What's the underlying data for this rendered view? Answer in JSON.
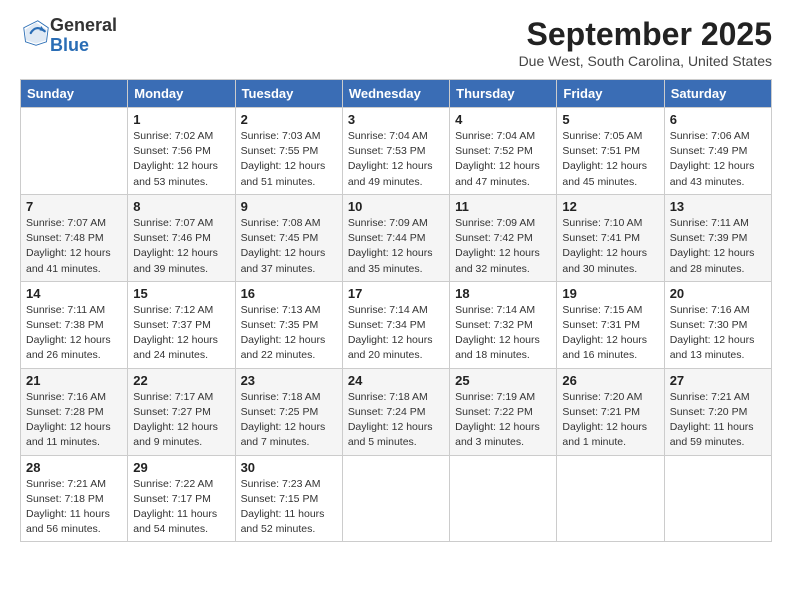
{
  "header": {
    "logo_general": "General",
    "logo_blue": "Blue",
    "month_title": "September 2025",
    "location": "Due West, South Carolina, United States"
  },
  "columns": [
    "Sunday",
    "Monday",
    "Tuesday",
    "Wednesday",
    "Thursday",
    "Friday",
    "Saturday"
  ],
  "weeks": [
    [
      {
        "day": "",
        "info": ""
      },
      {
        "day": "1",
        "info": "Sunrise: 7:02 AM\nSunset: 7:56 PM\nDaylight: 12 hours\nand 53 minutes."
      },
      {
        "day": "2",
        "info": "Sunrise: 7:03 AM\nSunset: 7:55 PM\nDaylight: 12 hours\nand 51 minutes."
      },
      {
        "day": "3",
        "info": "Sunrise: 7:04 AM\nSunset: 7:53 PM\nDaylight: 12 hours\nand 49 minutes."
      },
      {
        "day": "4",
        "info": "Sunrise: 7:04 AM\nSunset: 7:52 PM\nDaylight: 12 hours\nand 47 minutes."
      },
      {
        "day": "5",
        "info": "Sunrise: 7:05 AM\nSunset: 7:51 PM\nDaylight: 12 hours\nand 45 minutes."
      },
      {
        "day": "6",
        "info": "Sunrise: 7:06 AM\nSunset: 7:49 PM\nDaylight: 12 hours\nand 43 minutes."
      }
    ],
    [
      {
        "day": "7",
        "info": "Sunrise: 7:07 AM\nSunset: 7:48 PM\nDaylight: 12 hours\nand 41 minutes."
      },
      {
        "day": "8",
        "info": "Sunrise: 7:07 AM\nSunset: 7:46 PM\nDaylight: 12 hours\nand 39 minutes."
      },
      {
        "day": "9",
        "info": "Sunrise: 7:08 AM\nSunset: 7:45 PM\nDaylight: 12 hours\nand 37 minutes."
      },
      {
        "day": "10",
        "info": "Sunrise: 7:09 AM\nSunset: 7:44 PM\nDaylight: 12 hours\nand 35 minutes."
      },
      {
        "day": "11",
        "info": "Sunrise: 7:09 AM\nSunset: 7:42 PM\nDaylight: 12 hours\nand 32 minutes."
      },
      {
        "day": "12",
        "info": "Sunrise: 7:10 AM\nSunset: 7:41 PM\nDaylight: 12 hours\nand 30 minutes."
      },
      {
        "day": "13",
        "info": "Sunrise: 7:11 AM\nSunset: 7:39 PM\nDaylight: 12 hours\nand 28 minutes."
      }
    ],
    [
      {
        "day": "14",
        "info": "Sunrise: 7:11 AM\nSunset: 7:38 PM\nDaylight: 12 hours\nand 26 minutes."
      },
      {
        "day": "15",
        "info": "Sunrise: 7:12 AM\nSunset: 7:37 PM\nDaylight: 12 hours\nand 24 minutes."
      },
      {
        "day": "16",
        "info": "Sunrise: 7:13 AM\nSunset: 7:35 PM\nDaylight: 12 hours\nand 22 minutes."
      },
      {
        "day": "17",
        "info": "Sunrise: 7:14 AM\nSunset: 7:34 PM\nDaylight: 12 hours\nand 20 minutes."
      },
      {
        "day": "18",
        "info": "Sunrise: 7:14 AM\nSunset: 7:32 PM\nDaylight: 12 hours\nand 18 minutes."
      },
      {
        "day": "19",
        "info": "Sunrise: 7:15 AM\nSunset: 7:31 PM\nDaylight: 12 hours\nand 16 minutes."
      },
      {
        "day": "20",
        "info": "Sunrise: 7:16 AM\nSunset: 7:30 PM\nDaylight: 12 hours\nand 13 minutes."
      }
    ],
    [
      {
        "day": "21",
        "info": "Sunrise: 7:16 AM\nSunset: 7:28 PM\nDaylight: 12 hours\nand 11 minutes."
      },
      {
        "day": "22",
        "info": "Sunrise: 7:17 AM\nSunset: 7:27 PM\nDaylight: 12 hours\nand 9 minutes."
      },
      {
        "day": "23",
        "info": "Sunrise: 7:18 AM\nSunset: 7:25 PM\nDaylight: 12 hours\nand 7 minutes."
      },
      {
        "day": "24",
        "info": "Sunrise: 7:18 AM\nSunset: 7:24 PM\nDaylight: 12 hours\nand 5 minutes."
      },
      {
        "day": "25",
        "info": "Sunrise: 7:19 AM\nSunset: 7:22 PM\nDaylight: 12 hours\nand 3 minutes."
      },
      {
        "day": "26",
        "info": "Sunrise: 7:20 AM\nSunset: 7:21 PM\nDaylight: 12 hours\nand 1 minute."
      },
      {
        "day": "27",
        "info": "Sunrise: 7:21 AM\nSunset: 7:20 PM\nDaylight: 11 hours\nand 59 minutes."
      }
    ],
    [
      {
        "day": "28",
        "info": "Sunrise: 7:21 AM\nSunset: 7:18 PM\nDaylight: 11 hours\nand 56 minutes."
      },
      {
        "day": "29",
        "info": "Sunrise: 7:22 AM\nSunset: 7:17 PM\nDaylight: 11 hours\nand 54 minutes."
      },
      {
        "day": "30",
        "info": "Sunrise: 7:23 AM\nSunset: 7:15 PM\nDaylight: 11 hours\nand 52 minutes."
      },
      {
        "day": "",
        "info": ""
      },
      {
        "day": "",
        "info": ""
      },
      {
        "day": "",
        "info": ""
      },
      {
        "day": "",
        "info": ""
      }
    ]
  ]
}
